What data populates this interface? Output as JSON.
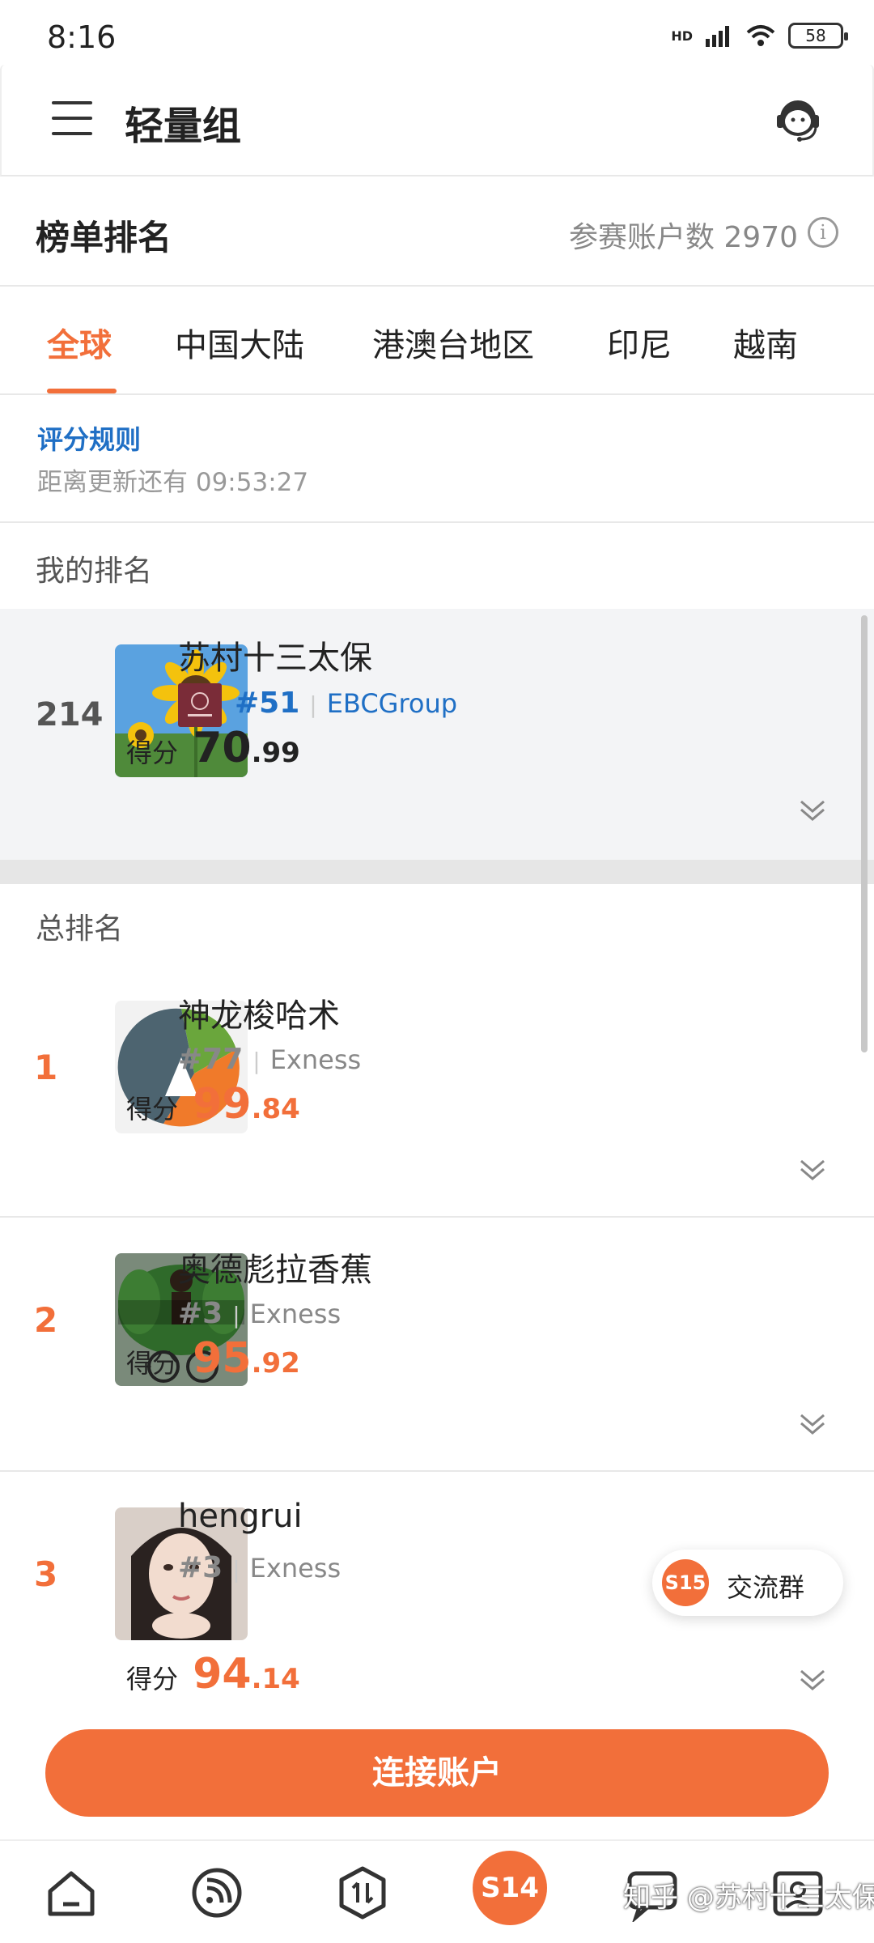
{
  "status": {
    "time": "8:16",
    "battery": "58",
    "network": "HD"
  },
  "header": {
    "title": "轻量组"
  },
  "ranking": {
    "title": "榜单排名",
    "participants_label": "参赛账户数 2970"
  },
  "tabs": [
    "全球",
    "中国大陆",
    "港澳台地区",
    "印尼",
    "越南"
  ],
  "active_tab": 0,
  "rules": {
    "link": "评分规则",
    "countdown": "距离更新还有 09:53:27"
  },
  "my_rank": {
    "section_label": "我的排名",
    "position": "214",
    "name": "苏村十三太保",
    "rank_tag": "#51",
    "broker": "EBCGroup",
    "score_label": "得分",
    "score_int": "70",
    "score_dec": ".99"
  },
  "total": {
    "section_label": "总排名",
    "rows": [
      {
        "position": "1",
        "name": "神龙梭哈术",
        "rank_tag": "#77",
        "broker": "Exness",
        "score_label": "得分",
        "score_int": "99",
        "score_dec": ".84"
      },
      {
        "position": "2",
        "name": "奥德彪拉香蕉",
        "rank_tag": "#3",
        "broker": "Exness",
        "score_label": "得分",
        "score_int": "95",
        "score_dec": ".92"
      },
      {
        "position": "3",
        "name": "hengrui",
        "rank_tag": "#3",
        "broker": "Exness",
        "score_label": "得分",
        "score_int": "94",
        "score_dec": ".14"
      }
    ]
  },
  "float": {
    "badge": "S15",
    "label": "交流群"
  },
  "connect_button": "连接账户",
  "bottom_nav": {
    "center_badge": "S14",
    "watermark": "知乎 @苏村十三太保"
  },
  "colors": {
    "accent": "#f26f3a",
    "link": "#1f6fc5",
    "muted": "#999999"
  }
}
